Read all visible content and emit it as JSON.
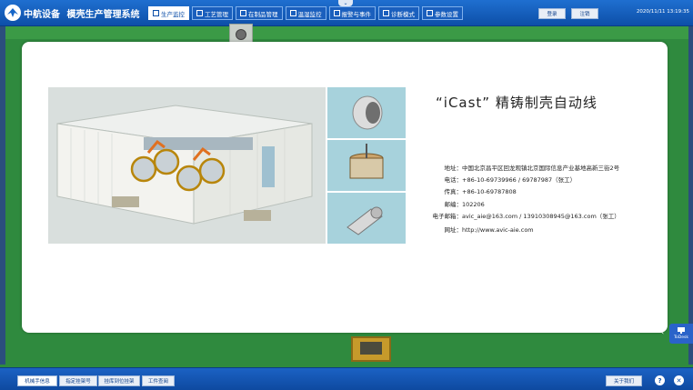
{
  "header": {
    "logo_text": "中航设备",
    "system_name": "模壳生产管理系统",
    "datetime": "2020/11/11  13:19:35",
    "buttons": {
      "login": "登录",
      "logout": "注销"
    },
    "nav": [
      {
        "label": "生产监控",
        "active": true,
        "icon": "monitor-icon"
      },
      {
        "label": "工艺管理",
        "active": false,
        "icon": "process-icon"
      },
      {
        "label": "在制品管理",
        "active": false,
        "icon": "wip-icon"
      },
      {
        "label": "温湿监控",
        "active": false,
        "icon": "thermo-icon"
      },
      {
        "label": "报警与事件",
        "active": false,
        "icon": "alarm-icon"
      },
      {
        "label": "诊断模式",
        "active": false,
        "icon": "diagnose-icon"
      },
      {
        "label": "参数设置",
        "active": false,
        "icon": "settings-icon"
      }
    ]
  },
  "panel": {
    "title": "“iCast” 精铸制壳自动线",
    "info": [
      {
        "label": "地址：",
        "value": "中国北京昌平区回龙观镇北京国际信息产业基地高新三街2号"
      },
      {
        "label": "电话：",
        "value": "+86-10-69739966  /  69787987（张工）"
      },
      {
        "label": "传真：",
        "value": "+86-10-69787808"
      },
      {
        "label": "邮编：",
        "value": "102206"
      },
      {
        "label": "电子邮箱：",
        "value": "avic_aie@163.com  / 13910308945@163.com（张工）"
      },
      {
        "label": "网址：",
        "value": "http://www.avic-aie.com"
      }
    ]
  },
  "todesk": {
    "label": "ToDesk"
  },
  "footer": {
    "buttons": [
      {
        "label": "机械手信息",
        "active": true
      },
      {
        "label": "指定挂架号",
        "active": false
      },
      {
        "label": "挂库到位挂架",
        "active": false
      },
      {
        "label": "工件查阅",
        "active": false
      }
    ],
    "about": "关于我们"
  },
  "colors": {
    "header_blue": "#1565c8",
    "active_tab": "#ffffff",
    "floor_green": "#2f8a3e"
  }
}
